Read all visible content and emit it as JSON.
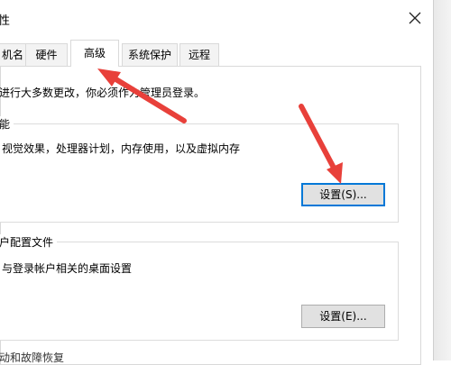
{
  "window": {
    "title": "性",
    "close_icon": "close-icon"
  },
  "tabs": [
    {
      "label": "机名",
      "active": false
    },
    {
      "label": "硬件",
      "active": false
    },
    {
      "label": "高级",
      "active": true
    },
    {
      "label": "系统保护",
      "active": false
    },
    {
      "label": "远程",
      "active": false
    }
  ],
  "advanced": {
    "admin_note": "进行大多数更改，你必须作为管理员登录。",
    "performance": {
      "title": "能",
      "description": "视觉效果，处理器计划，内存使用，以及虚拟内存",
      "settings_button": "设置(S)..."
    },
    "user_profiles": {
      "title": "户配置文件",
      "description": "与登录帐户相关的桌面设置",
      "settings_button": "设置(E)..."
    },
    "startup_recovery_partial": "动和故障恢复"
  },
  "annotation": {
    "arrow_color": "#e8403a",
    "arrow_count": 2
  }
}
